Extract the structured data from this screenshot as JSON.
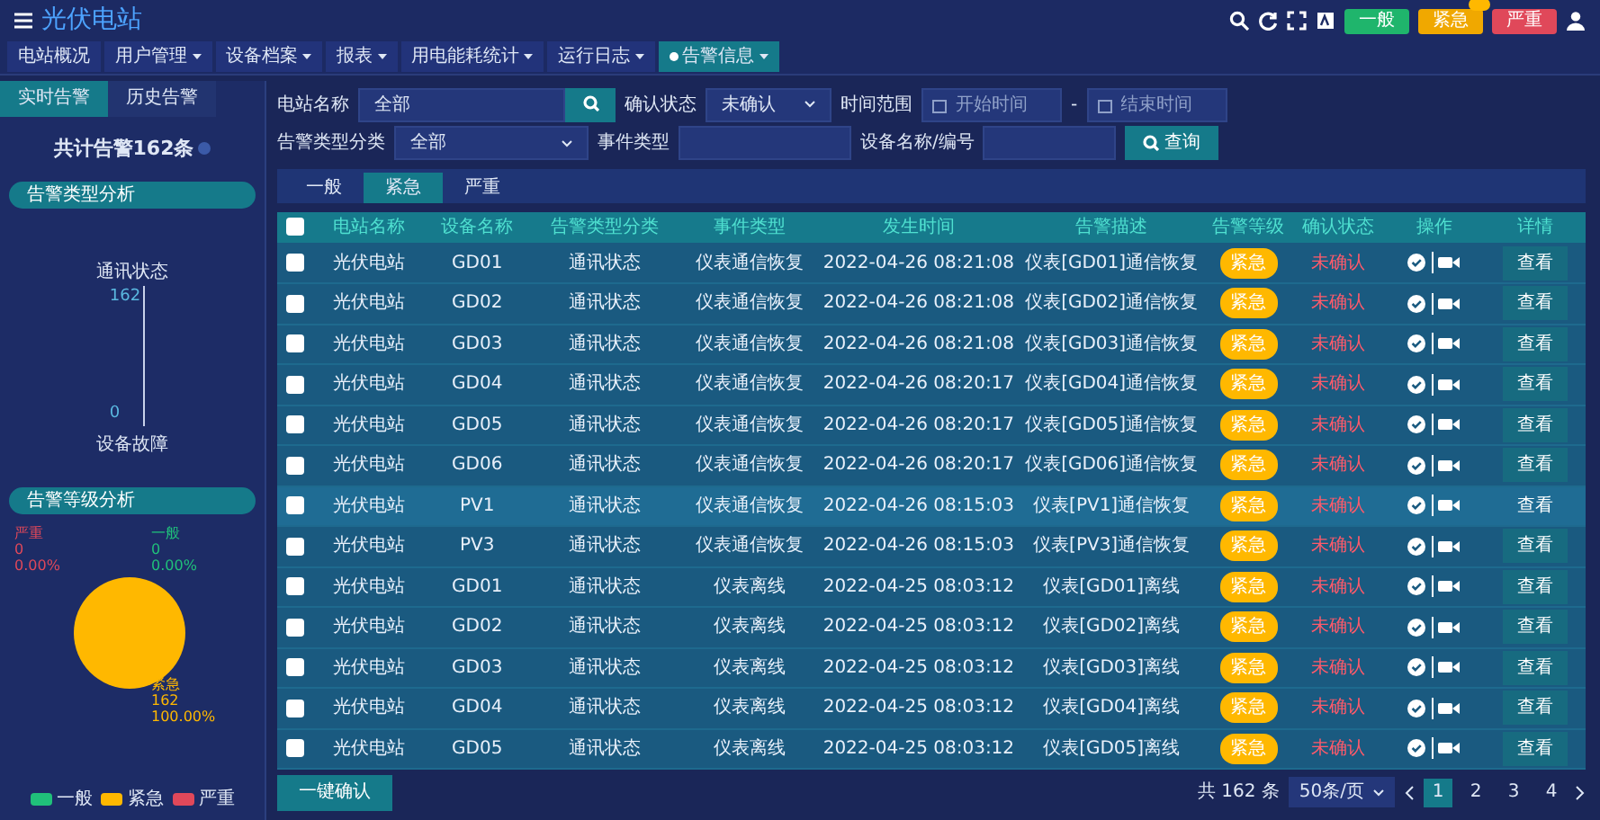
{
  "header": {
    "title": "光伏电站",
    "alarm_buttons": [
      {
        "label": "一般",
        "kind": "general"
      },
      {
        "label": "紧急",
        "kind": "urgent"
      },
      {
        "label": "严重",
        "kind": "severe"
      }
    ]
  },
  "nav": [
    {
      "label": "电站概况",
      "dropdown": false,
      "selected": false
    },
    {
      "label": "用户管理",
      "dropdown": true,
      "selected": false
    },
    {
      "label": "设备档案",
      "dropdown": true,
      "selected": false
    },
    {
      "label": "报表",
      "dropdown": true,
      "selected": false
    },
    {
      "label": "用电能耗统计",
      "dropdown": true,
      "selected": false
    },
    {
      "label": "运行日志",
      "dropdown": true,
      "selected": false
    },
    {
      "label": "告警信息",
      "dropdown": true,
      "selected": true
    }
  ],
  "sidebar": {
    "tabs": [
      {
        "label": "实时告警",
        "selected": true
      },
      {
        "label": "历史告警",
        "selected": false
      }
    ],
    "total": "共计告警162条",
    "type_analysis": {
      "title": "告警类型分析",
      "top_label": "通讯状态",
      "values": [
        "162",
        "0"
      ],
      "bottom_label": "设备故障"
    },
    "level_analysis": {
      "title": "告警等级分析",
      "chart_data": {
        "type": "pie",
        "categories": [
          "严重",
          "一般",
          "紧急"
        ],
        "series": [
          {
            "values": [
              0,
              0,
              100
            ]
          }
        ]
      },
      "slices": [
        {
          "count": "0",
          "percent": "0.00%",
          "color": "#e0485a"
        },
        {
          "count": "0",
          "percent": "0.00%",
          "color": "#20c07a"
        },
        {
          "count": "162",
          "percent": "100.00%",
          "color": "#ffb800"
        }
      ],
      "legend": [
        {
          "label": "一般",
          "color": "#20c07a"
        },
        {
          "label": "紧急",
          "color": "#ffb800"
        },
        {
          "label": "严重",
          "color": "#e0485a"
        }
      ]
    }
  },
  "filter_rows": [
    [
      {
        "label": "电站名称",
        "kind": "search",
        "value": "全部"
      },
      {
        "label": "确认状态",
        "kind": "select",
        "value": "未确认"
      },
      {
        "label": "时间范围",
        "kind": "daterange",
        "placeholders": [
          "开始时间",
          "结束时间"
        ],
        "separator": "-"
      }
    ],
    [
      {
        "label": "告警类型分类",
        "kind": "select",
        "value": "全部"
      },
      {
        "label": "事件类型",
        "kind": "text"
      },
      {
        "label": "设备名称/编号",
        "kind": "text"
      }
    ]
  ],
  "query_button": "查询",
  "level_tabs": [
    {
      "label": "一般",
      "selected": false
    },
    {
      "label": "紧急",
      "selected": true
    },
    {
      "label": "严重",
      "selected": false
    }
  ],
  "table": {
    "header_checked": false,
    "columns": [
      "电站名称",
      "设备名称",
      "告警类型分类",
      "事件类型",
      "发生时间",
      "告警描述",
      "告警等级",
      "确认状态",
      "操作",
      "详情"
    ],
    "rows": [
      {
        "checked": false,
        "highlighted": false,
        "cells": [
          "光伏电站",
          "GD01",
          "通讯状态",
          "仪表通信恢复",
          "2022-04-26 08:21:08",
          "仪表[GD01]通信恢复"
        ],
        "level": "紧急",
        "confirm": "未确认",
        "detail": "查看"
      },
      {
        "checked": false,
        "highlighted": false,
        "cells": [
          "光伏电站",
          "GD02",
          "通讯状态",
          "仪表通信恢复",
          "2022-04-26 08:21:08",
          "仪表[GD02]通信恢复"
        ],
        "level": "紧急",
        "confirm": "未确认",
        "detail": "查看"
      },
      {
        "checked": false,
        "highlighted": false,
        "cells": [
          "光伏电站",
          "GD03",
          "通讯状态",
          "仪表通信恢复",
          "2022-04-26 08:21:08",
          "仪表[GD03]通信恢复"
        ],
        "level": "紧急",
        "confirm": "未确认",
        "detail": "查看"
      },
      {
        "checked": false,
        "highlighted": false,
        "cells": [
          "光伏电站",
          "GD04",
          "通讯状态",
          "仪表通信恢复",
          "2022-04-26 08:20:17",
          "仪表[GD04]通信恢复"
        ],
        "level": "紧急",
        "confirm": "未确认",
        "detail": "查看"
      },
      {
        "checked": false,
        "highlighted": false,
        "cells": [
          "光伏电站",
          "GD05",
          "通讯状态",
          "仪表通信恢复",
          "2022-04-26 08:20:17",
          "仪表[GD05]通信恢复"
        ],
        "level": "紧急",
        "confirm": "未确认",
        "detail": "查看"
      },
      {
        "checked": false,
        "highlighted": false,
        "cells": [
          "光伏电站",
          "GD06",
          "通讯状态",
          "仪表通信恢复",
          "2022-04-26 08:20:17",
          "仪表[GD06]通信恢复"
        ],
        "level": "紧急",
        "confirm": "未确认",
        "detail": "查看"
      },
      {
        "checked": false,
        "highlighted": true,
        "cells": [
          "光伏电站",
          "PV1",
          "通讯状态",
          "仪表通信恢复",
          "2022-04-26 08:15:03",
          "仪表[PV1]通信恢复"
        ],
        "level": "紧急",
        "confirm": "未确认",
        "detail": "查看"
      },
      {
        "checked": false,
        "highlighted": false,
        "cells": [
          "光伏电站",
          "PV3",
          "通讯状态",
          "仪表通信恢复",
          "2022-04-26 08:15:03",
          "仪表[PV3]通信恢复"
        ],
        "level": "紧急",
        "confirm": "未确认",
        "detail": "查看"
      },
      {
        "checked": false,
        "highlighted": false,
        "cells": [
          "光伏电站",
          "GD01",
          "通讯状态",
          "仪表离线",
          "2022-04-25 08:03:12",
          "仪表[GD01]离线"
        ],
        "level": "紧急",
        "confirm": "未确认",
        "detail": "查看"
      },
      {
        "checked": false,
        "highlighted": false,
        "cells": [
          "光伏电站",
          "GD02",
          "通讯状态",
          "仪表离线",
          "2022-04-25 08:03:12",
          "仪表[GD02]离线"
        ],
        "level": "紧急",
        "confirm": "未确认",
        "detail": "查看"
      },
      {
        "checked": false,
        "highlighted": false,
        "cells": [
          "光伏电站",
          "GD03",
          "通讯状态",
          "仪表离线",
          "2022-04-25 08:03:12",
          "仪表[GD03]离线"
        ],
        "level": "紧急",
        "confirm": "未确认",
        "detail": "查看"
      },
      {
        "checked": false,
        "highlighted": false,
        "cells": [
          "光伏电站",
          "GD04",
          "通讯状态",
          "仪表离线",
          "2022-04-25 08:03:12",
          "仪表[GD04]离线"
        ],
        "level": "紧急",
        "confirm": "未确认",
        "detail": "查看"
      },
      {
        "checked": false,
        "highlighted": false,
        "cells": [
          "光伏电站",
          "GD05",
          "通讯状态",
          "仪表离线",
          "2022-04-25 08:03:12",
          "仪表[GD05]离线"
        ],
        "level": "紧急",
        "confirm": "未确认",
        "detail": "查看"
      }
    ]
  },
  "confirm_all_button": "一键确认",
  "pagination": {
    "total": "共 162 条",
    "page_size": "50条/页",
    "pages": [
      {
        "label": "1",
        "selected": true
      },
      {
        "label": "2",
        "selected": false
      },
      {
        "label": "3",
        "selected": false
      },
      {
        "label": "4",
        "selected": false
      }
    ]
  }
}
